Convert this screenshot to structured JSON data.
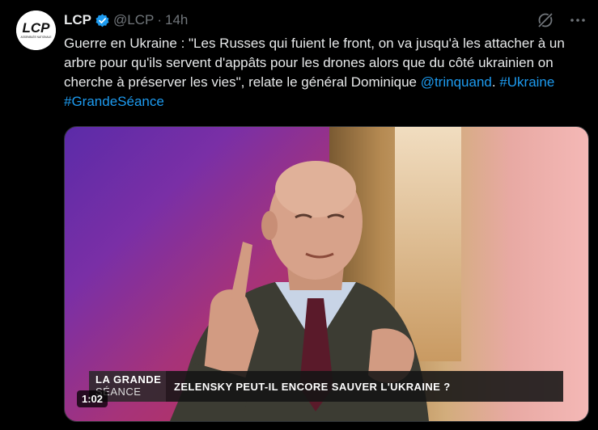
{
  "author": {
    "name": "LCP",
    "handle": "@LCP",
    "separator": "·",
    "time": "14h",
    "avatar_text": "LCP",
    "avatar_subtext": "ASSEMBLÉE NATIONALE",
    "verified_color": "#1d9bf0"
  },
  "header_icons": [
    "grok-icon",
    "more-icon"
  ],
  "tweet": {
    "text_part1": "Guerre en Ukraine : \"Les Russes qui fuient le front, on va jusqu'à les attacher à un arbre pour qu'ils servent d'appâts pour les drones alors que du côté ukrainien on cherche à préserver les vies\", relate le général Dominique ",
    "mention": "@trinquand",
    "text_part2": ". ",
    "hashtag1": "#Ukraine",
    "space": " ",
    "hashtag2": "#GrandeSéance",
    "link_color": "#1d9bf0"
  },
  "video": {
    "chyron_logo_top": "LA GRANDE",
    "chyron_logo_bottom": "SÉANCE",
    "chyron_title": "ZELENSKY PEUT-IL ENCORE SAUVER L'UKRAINE ?",
    "duration": "1:02"
  }
}
